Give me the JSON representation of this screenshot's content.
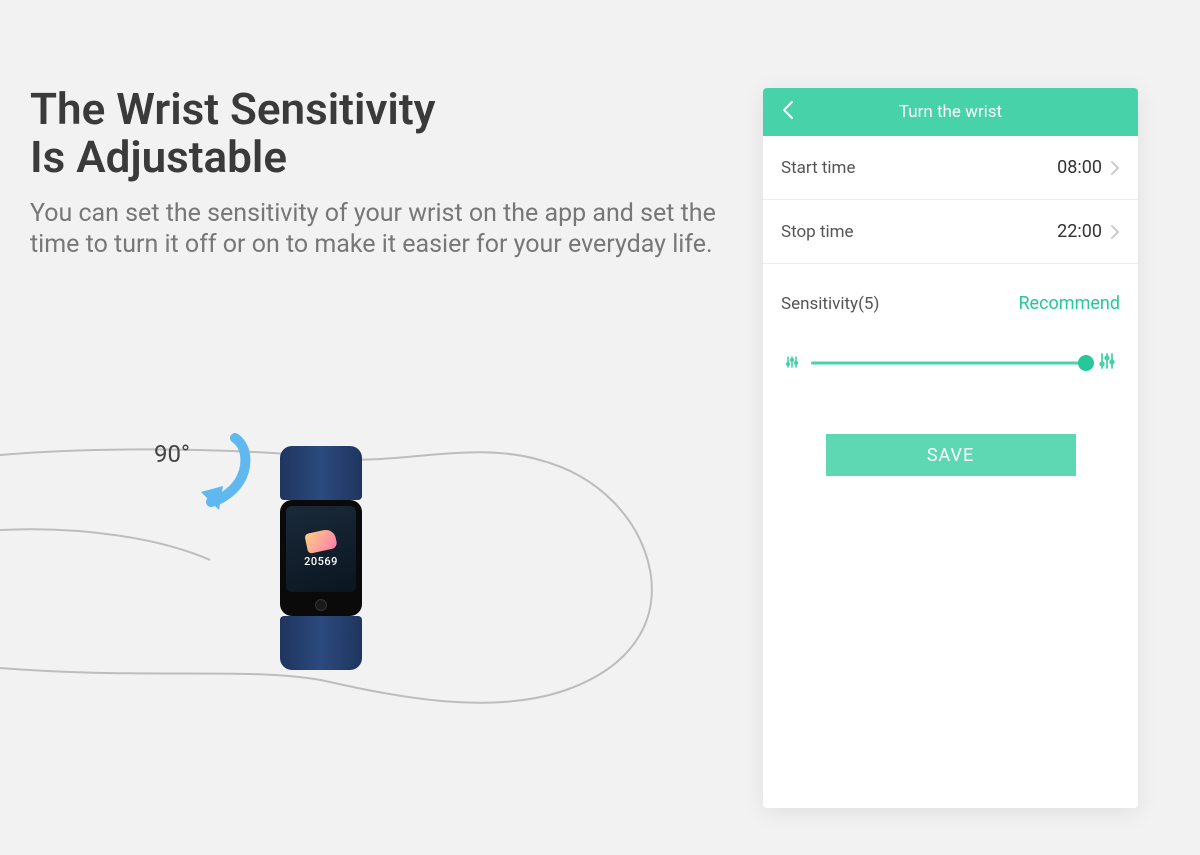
{
  "heading_line1": "The Wrist Sensitivity",
  "heading_line2": "Is Adjustable",
  "description": "You can set the sensitivity of your wrist on the app and set the time to turn it off or on to make it easier for your everyday life.",
  "angle_label": "90°",
  "watch": {
    "steps": "20569"
  },
  "phone": {
    "title": "Turn the wrist",
    "start_label": "Start time",
    "start_value": "08:00",
    "stop_label": "Stop time",
    "stop_value": "22:00",
    "sensitivity_label": "Sensitivity(5)",
    "recommend_label": "Recommend",
    "slider_percent": 100,
    "save_label": "SAVE"
  },
  "colors": {
    "accent": "#47d2a9"
  }
}
